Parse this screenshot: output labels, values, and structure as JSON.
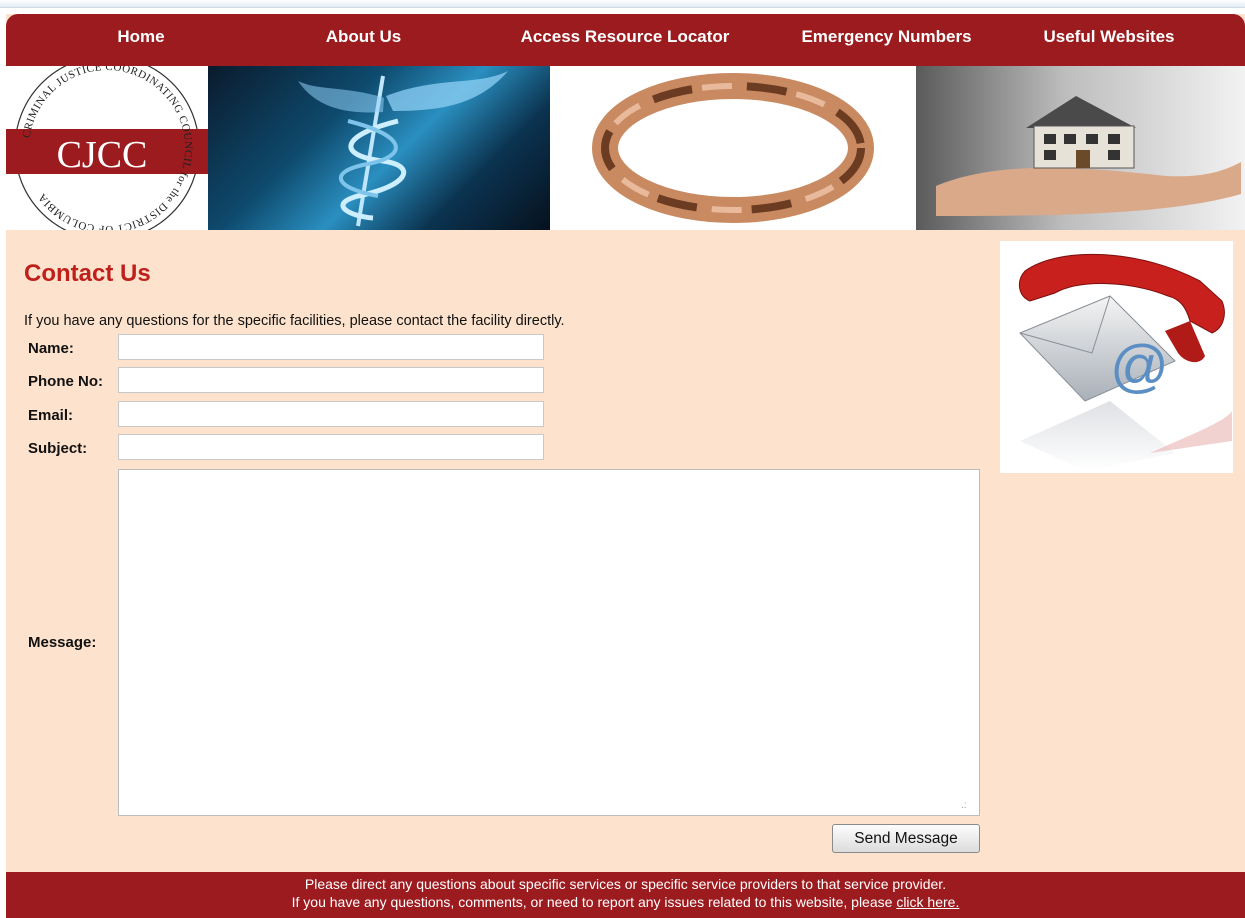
{
  "nav": {
    "items": [
      {
        "label": "Home"
      },
      {
        "label": "About Us"
      },
      {
        "label": "Access Resource Locator"
      },
      {
        "label": "Emergency Numbers"
      },
      {
        "label": "Useful Websites"
      }
    ]
  },
  "logo": {
    "text": "CJCC",
    "ring_text": "CRIMINAL JUSTICE COORDINATING COUNCIL for the DISTRICT OF COLUMBIA"
  },
  "main": {
    "title": "Contact Us",
    "intro": "If you have any questions for the specific facilities, please contact the facility directly.",
    "form": {
      "name_label": "Name:",
      "phone_label": "Phone No:",
      "email_label": "Email:",
      "subject_label": "Subject:",
      "message_label": "Message:",
      "name_value": "",
      "phone_value": "",
      "email_value": "",
      "subject_value": "",
      "send_label": "Send Message"
    }
  },
  "footer": {
    "line1": "Please direct any questions about specific services or specific service providers to that service provider.",
    "line2": "If you have any questions, comments, or need to report any issues related to this website, please ",
    "link": "click here."
  },
  "colors": {
    "brand": "#9c1b1f",
    "background": "#fde3cd",
    "title": "#c0201c"
  }
}
